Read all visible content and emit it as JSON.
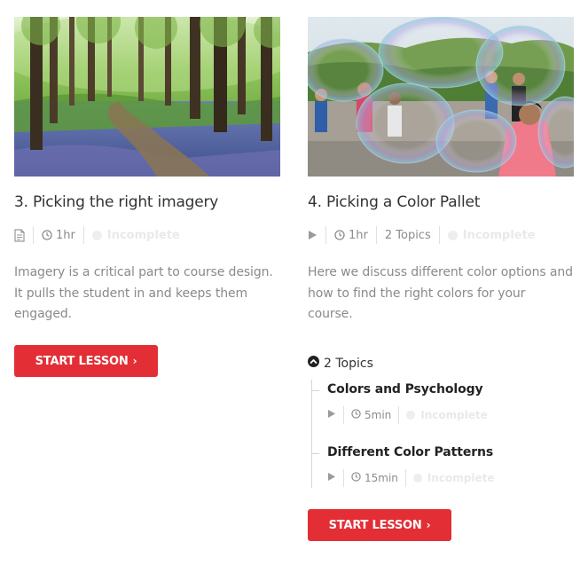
{
  "lessons": [
    {
      "title": "3. Picking the right imagery",
      "duration": "1hr",
      "status": "Incomplete",
      "description": "Imagery is a critical part to course design. It pulls the student in and keeps them engaged.",
      "button_label": "START LESSON",
      "image": "bluebell-forest-path-photo",
      "type_icon": "document-icon"
    },
    {
      "title": "4. Picking a Color Pallet",
      "duration": "1hr",
      "topics_count": "2 Topics",
      "status": "Incomplete",
      "description": "Here we discuss different color options and how to find the right colors for your course.",
      "button_label": "START LESSON",
      "image": "soap-bubbles-children-photo",
      "type_icon": "play-icon",
      "topics_toggle_label": "2 Topics",
      "topics": [
        {
          "title": "Colors and Psychology",
          "duration": "5min",
          "status": "Incomplete"
        },
        {
          "title": "Different Color Patterns",
          "duration": "15min",
          "status": "Incomplete"
        }
      ]
    }
  ],
  "colors": {
    "accent": "#e32e35",
    "muted_text": "#8a8a8a",
    "status_faded": "#e9e9e9"
  },
  "icons": {
    "duration": "clock-icon",
    "topics_toggle": "chevron-up-circle-icon",
    "button_chevron": "chevron-right-icon"
  }
}
